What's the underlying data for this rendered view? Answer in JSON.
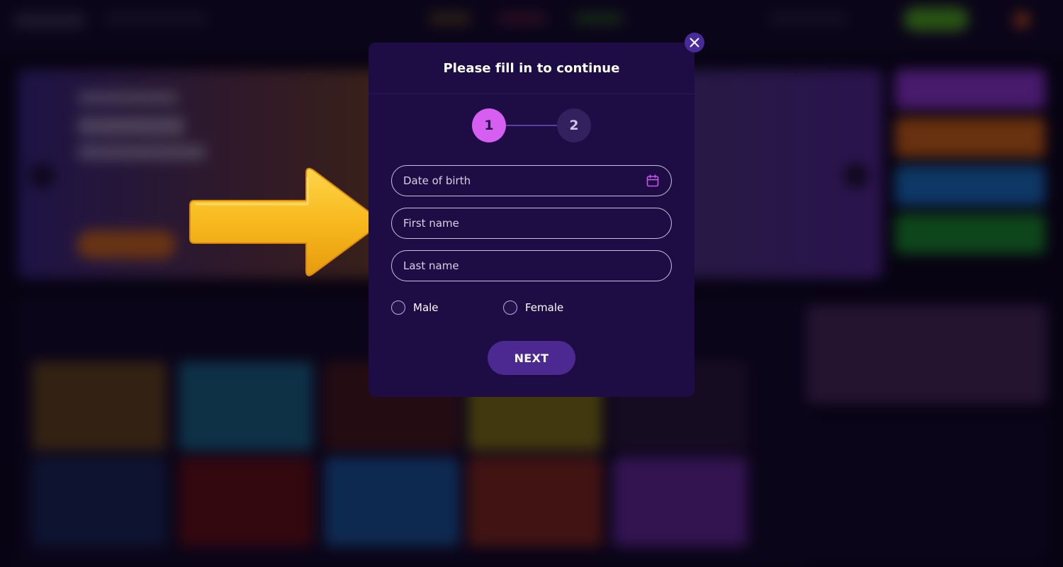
{
  "modal": {
    "title": "Please fill in to continue",
    "steps": [
      {
        "label": "1",
        "state": "active"
      },
      {
        "label": "2",
        "state": "inactive"
      }
    ],
    "fields": {
      "date_of_birth": {
        "placeholder": "Date of birth",
        "value": ""
      },
      "first_name": {
        "placeholder": "First name",
        "value": ""
      },
      "last_name": {
        "placeholder": "Last name",
        "value": ""
      }
    },
    "gender_options": [
      {
        "label": "Male",
        "selected": false
      },
      {
        "label": "Female",
        "selected": false
      }
    ],
    "next_label": "NEXT"
  },
  "icons": {
    "close": "close-icon",
    "calendar": "calendar-icon",
    "pointer": "pointer-arrow"
  },
  "colors": {
    "modal_bg": "#1d0d44",
    "step_active": "#d65ef0",
    "step_inactive": "#33205e",
    "next_button": "#4b2990",
    "calendar_icon": "#c857e8",
    "arrow": "#f6b81e"
  }
}
